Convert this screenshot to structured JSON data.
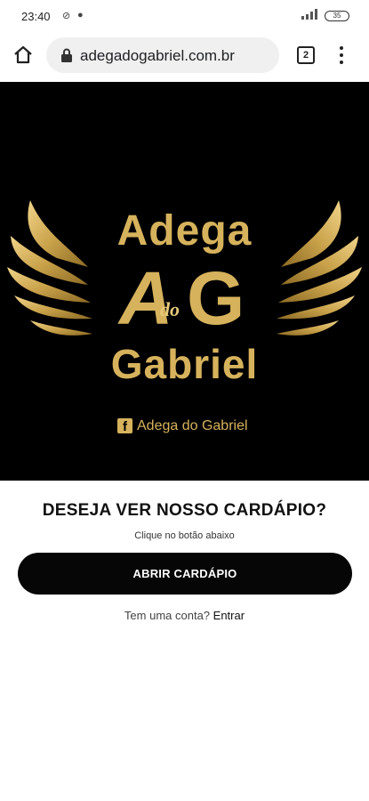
{
  "status_bar": {
    "time": "23:40",
    "battery": "35"
  },
  "browser": {
    "url": "adegadogabriel.com.br",
    "tab_count": "2"
  },
  "hero": {
    "brand_line1": "Adega",
    "monogram_a": "A",
    "monogram_do": "do",
    "monogram_g": "G",
    "brand_line2": "Gabriel",
    "facebook_glyph": "f",
    "facebook_text": "Adega do Gabriel",
    "colors": {
      "background": "#000000",
      "gold": "#d6b25c"
    }
  },
  "main": {
    "headline": "DESEJA VER NOSSO CARDÁPIO?",
    "subtitle": "Clique no botão abaixo",
    "cta_label": "ABRIR CARDÁPIO",
    "login_prompt": "Tem uma conta?",
    "login_link": "Entrar"
  }
}
